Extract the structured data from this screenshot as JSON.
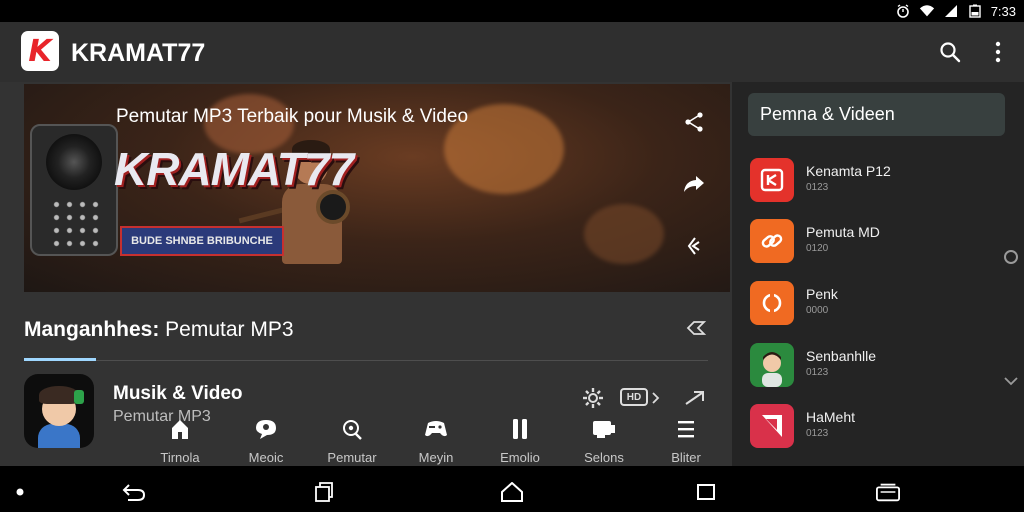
{
  "status_bar": {
    "time": "7:33"
  },
  "app_bar": {
    "logo_letter": "K",
    "title": "KRAMAT77"
  },
  "banner": {
    "title": "Pemutar MP3 Terbaik pour Musik & Video",
    "brand_text": "KRAMAT77",
    "ribbon_text": "BUDE SHNBE BRIBUNCHE"
  },
  "section": {
    "title_bold": "Manganhhes:",
    "title_rest": " Pemutar MP3"
  },
  "row": {
    "title": "Musik & Video",
    "subtitle": "Pemutar MP3",
    "badge": "HD"
  },
  "bottom_nav": [
    {
      "label": "Tirnola",
      "icon": "home-icon"
    },
    {
      "label": "Meoic",
      "icon": "chat-icon"
    },
    {
      "label": "Pemutar",
      "icon": "podcast-icon"
    },
    {
      "label": "Meyin",
      "icon": "gamepad-icon"
    },
    {
      "label": "Emolio",
      "icon": "pause-icon"
    },
    {
      "label": "Selons",
      "icon": "cast-icon"
    },
    {
      "label": "Bliter",
      "icon": "menu-icon"
    }
  ],
  "right_panel": {
    "header": "Pemna & Videen",
    "items": [
      {
        "name": "Kenamta P12",
        "meta": "0123",
        "color": "#e4322b",
        "icon": "square-logo-icon"
      },
      {
        "name": "Pemuta MD",
        "meta": "0120",
        "color": "#f06a22",
        "icon": "link-icon"
      },
      {
        "name": "Penk",
        "meta": "0000",
        "color": "#f06a22",
        "icon": "sync-icon"
      },
      {
        "name": "Senbanhlle",
        "meta": "0123",
        "color": "#2b8a3e",
        "icon": "avatar-icon"
      },
      {
        "name": "HaMeht",
        "meta": "0123",
        "color": "#d9314a",
        "icon": "triangle-logo-icon"
      }
    ]
  },
  "colors": {
    "accent": "#9fd7ff",
    "brand_red": "#e8242a"
  }
}
